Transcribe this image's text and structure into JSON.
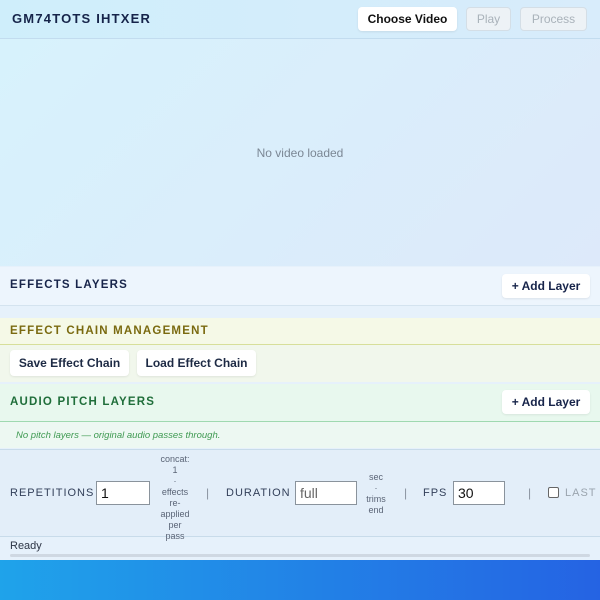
{
  "header": {
    "title": "GM74TOTS IHTXER",
    "choose_video_label": "Choose Video",
    "play_label": "Play",
    "process_label": "Process"
  },
  "video": {
    "empty_text": "No video loaded"
  },
  "effects_layers": {
    "title": "EFFECTS LAYERS",
    "add_label": "+ Add Layer"
  },
  "effect_chain": {
    "title": "EFFECT CHAIN MANAGEMENT",
    "save_label": "Save Effect Chain",
    "load_label": "Load Effect Chain"
  },
  "audio_pitch_layers": {
    "title": "AUDIO PITCH LAYERS",
    "add_label": "+ Add Layer",
    "empty_text": "No pitch layers — original audio passes through."
  },
  "controls": {
    "repetitions_label": "REPETITIONS",
    "repetitions_value": "1",
    "repetitions_note": [
      "concat:",
      "1",
      "·",
      "effects",
      "re-",
      "applied",
      "per",
      "pass"
    ],
    "separator": "|",
    "duration_label": "DURATION",
    "duration_placeholder": "full",
    "duration_note": [
      "sec",
      "·",
      "trims",
      "end"
    ],
    "fps_label": "FPS",
    "fps_value": "30",
    "last_label": "LAST F"
  },
  "status": {
    "text": "Ready",
    "progress": 0
  },
  "colors": {
    "accent": "#2a8ad6",
    "footer_start": "#1fa3ea",
    "footer_end": "#2563e3"
  }
}
